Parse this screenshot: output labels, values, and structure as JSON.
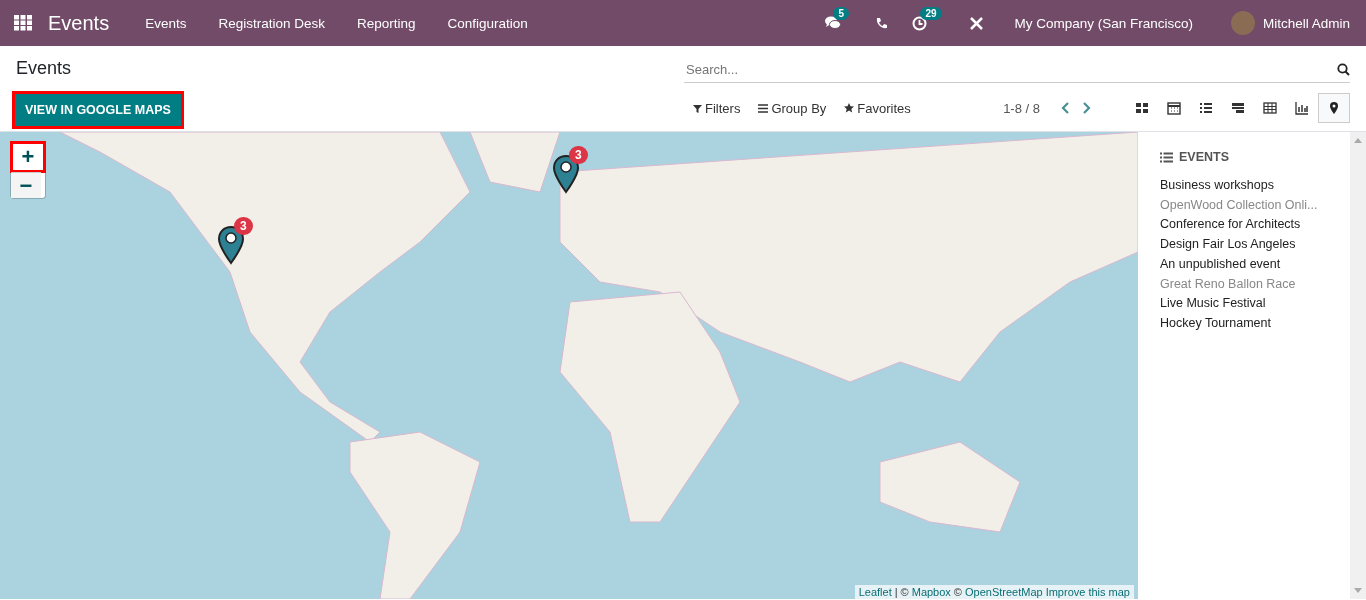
{
  "navbar": {
    "app_name": "Events",
    "menus": [
      "Events",
      "Registration Desk",
      "Reporting",
      "Configuration"
    ],
    "messages_count": "5",
    "activities_count": "29",
    "company": "My Company (San Francisco)",
    "user": "Mitchell Admin"
  },
  "control_panel": {
    "breadcrumb": "Events",
    "primary_button": "VIEW IN GOOGLE MAPS",
    "search": {
      "placeholder": "Search..."
    },
    "filters": [
      "Filters",
      "Group By",
      "Favorites"
    ],
    "pager": "1-8 / 8",
    "views": [
      {
        "kind": "kanban",
        "selected": false
      },
      {
        "kind": "calendar",
        "selected": false
      },
      {
        "kind": "list",
        "selected": false
      },
      {
        "kind": "gantt",
        "selected": false
      },
      {
        "kind": "pivot",
        "selected": false
      },
      {
        "kind": "graph",
        "selected": false
      },
      {
        "kind": "map",
        "selected": true
      }
    ]
  },
  "map": {
    "zoom_in": "+",
    "zoom_out": "−",
    "markers": [
      {
        "count": "3"
      },
      {
        "count": "3"
      }
    ],
    "attribution": [
      {
        "text": "Leaflet",
        "link": true
      },
      {
        "text": "| ©",
        "link": false
      },
      {
        "text": "Mapbox",
        "link": true
      },
      {
        "text": "©",
        "link": false
      },
      {
        "text": "OpenStreetMap",
        "link": true
      },
      {
        "text": "Improve this map",
        "link": true
      }
    ]
  },
  "sidebar": {
    "title": "EVENTS",
    "items": [
      {
        "name": "Business workshops",
        "muted": false
      },
      {
        "name": "OpenWood Collection Onli...",
        "muted": true
      },
      {
        "name": "Conference for Architects",
        "muted": false
      },
      {
        "name": "Design Fair Los Angeles",
        "muted": false
      },
      {
        "name": "An unpublished event",
        "muted": false
      },
      {
        "name": "Great Reno Ballon Race",
        "muted": true
      },
      {
        "name": "Live Music Festival",
        "muted": false
      },
      {
        "name": "Hockey Tournament",
        "muted": false
      }
    ]
  }
}
